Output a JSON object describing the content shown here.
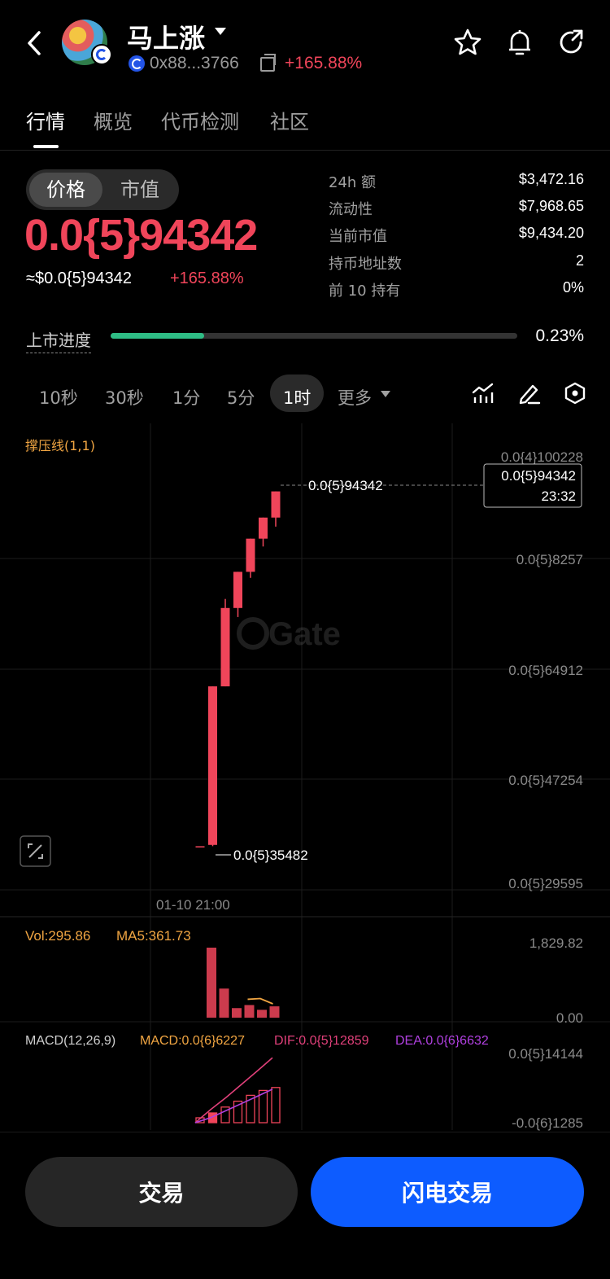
{
  "header": {
    "token_name": "马上涨",
    "address": "0x88...3766",
    "change": "+165.88%"
  },
  "tabs": [
    "行情",
    "概览",
    "代币检测",
    "社区"
  ],
  "price_toggle": [
    "价格",
    "市值"
  ],
  "price": {
    "main": "0.0{5}94342",
    "usd": "≈$0.0{5}94342",
    "change": "+165.88%"
  },
  "stats": [
    {
      "label": "24h  额",
      "value": "$3,472.16"
    },
    {
      "label": "流动性",
      "value": "$7,968.65"
    },
    {
      "label": "当前市值",
      "value": "$9,434.20"
    },
    {
      "label": "持币地址数",
      "value": "2"
    },
    {
      "label": "前 10 持有",
      "value": "0%"
    }
  ],
  "launch": {
    "label": "上市进度",
    "progress": 0.23,
    "value": "0.23%"
  },
  "intervals": [
    "10秒",
    "30秒",
    "1分",
    "5分",
    "1时",
    "更多"
  ],
  "active_interval": "1时",
  "colors": {
    "up": "#f0455a",
    "accent_blue": "#0d5cff",
    "progress_green": "#2ebd85",
    "indicator_orange": "#f0a542"
  },
  "chart_data": {
    "type": "candlestick",
    "indicator_label": "撑压线(1,1)",
    "watermark": "Gate",
    "y_axis_ticks": [
      "0.0{4}100228",
      "0.0{5}8257",
      "0.0{5}64912",
      "0.0{5}47254",
      "0.0{5}29595"
    ],
    "x_axis_ticks": [
      "01-10 21:00"
    ],
    "last_price_label": "0.0{5}94342",
    "last_price_box": [
      "0.0{5}94342",
      "23:32"
    ],
    "low_label": "0.0{5}35482",
    "candles": [
      {
        "open": 35482,
        "close": 35482,
        "high": 35482,
        "low": 35482
      },
      {
        "open": 35700,
        "close": 62000,
        "high": 62000,
        "low": 35482
      },
      {
        "open": 62000,
        "close": 75000,
        "high": 76500,
        "low": 62000
      },
      {
        "open": 75000,
        "close": 81000,
        "high": 81000,
        "low": 73500
      },
      {
        "open": 81000,
        "close": 86500,
        "high": 86500,
        "low": 80000
      },
      {
        "open": 86500,
        "close": 90000,
        "high": 90000,
        "low": 85200
      },
      {
        "open": 90000,
        "close": 94342,
        "high": 94342,
        "low": 88500
      }
    ],
    "volume": {
      "label": "Vol:295.86",
      "ma_label": "MA5:361.73",
      "ticks": [
        "1,829.82",
        "0.00"
      ],
      "bars": [
        1829.82,
        760,
        250,
        330,
        205,
        295.86
      ],
      "ma5": [
        480,
        500,
        361.73
      ]
    },
    "macd": {
      "label": "MACD(12,26,9)",
      "macd_label": "MACD:0.0{6}6227",
      "dif_label": "DIF:0.0{5}12859",
      "dea_label": "DEA:0.0{6}6632",
      "ticks": [
        "0.0{5}14144",
        "-0.0{6}1285"
      ],
      "hist": [
        0.5,
        1.0,
        1.6,
        2.2,
        2.8,
        3.3,
        3.6
      ],
      "dif": [
        0,
        2.6,
        5.0,
        7.6,
        10.2,
        12.86
      ],
      "dea": [
        0,
        1.0,
        2.4,
        3.8,
        5.2,
        6.63
      ]
    }
  },
  "buttons": {
    "trade": "交易",
    "flash_trade": "闪电交易"
  }
}
